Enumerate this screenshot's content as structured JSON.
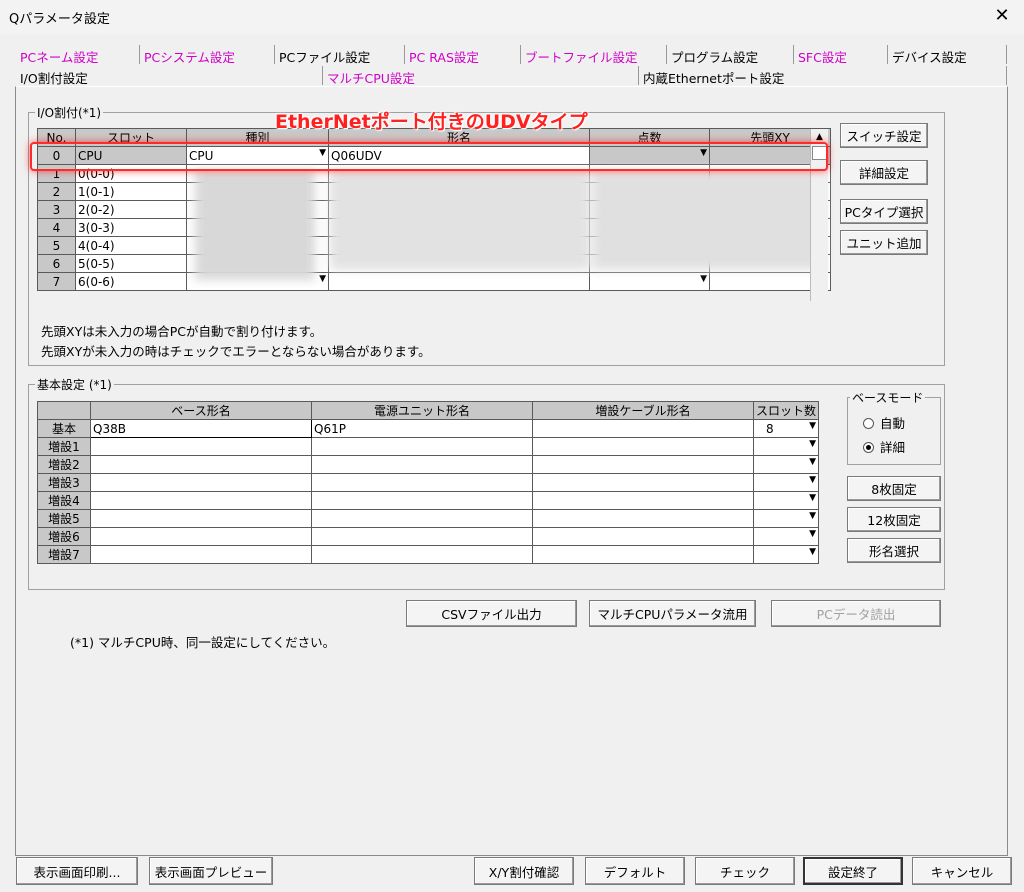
{
  "window": {
    "title": "Qパラメータ設定",
    "close_glyph": "✕"
  },
  "tabs_row1": [
    {
      "label": "PCネーム設定",
      "color": "#d000c8"
    },
    {
      "label": "PCシステム設定",
      "color": "#d000c8"
    },
    {
      "label": "PCファイル設定",
      "color": "#000000"
    },
    {
      "label": "PC RAS設定",
      "color": "#d000c8"
    },
    {
      "label": "ブートファイル設定",
      "color": "#d000c8"
    },
    {
      "label": "プログラム設定",
      "color": "#000000"
    },
    {
      "label": "SFC設定",
      "color": "#d000c8"
    },
    {
      "label": "デバイス設定",
      "color": "#000000"
    }
  ],
  "tabs_row2": [
    {
      "label": "I/O割付設定",
      "color": "#000000",
      "active": true
    },
    {
      "label": "マルチCPU設定",
      "color": "#d000c8"
    },
    {
      "label": "内蔵Ethernetポート設定",
      "color": "#000000"
    }
  ],
  "io": {
    "legend": "I/O割付(*1)",
    "callout": "EtherNetポート付きのUDVタイプ",
    "headers": [
      "No.",
      "スロット",
      "種別",
      "形名",
      "点数",
      "先頭XY"
    ],
    "rows": [
      {
        "no": "0",
        "slot": "CPU",
        "type": "CPU",
        "model": "Q06UDV",
        "points": "",
        "head": ""
      },
      {
        "no": "1",
        "slot": "0(0-0)"
      },
      {
        "no": "2",
        "slot": "1(0-1)"
      },
      {
        "no": "3",
        "slot": "2(0-2)"
      },
      {
        "no": "4",
        "slot": "3(0-3)"
      },
      {
        "no": "5",
        "slot": "4(0-4)"
      },
      {
        "no": "6",
        "slot": "5(0-5)"
      },
      {
        "no": "7",
        "slot": "6(0-6)"
      }
    ],
    "buttons": [
      "スイッチ設定",
      "詳細設定",
      "PCタイプ選択",
      "ユニット追加"
    ],
    "note1": "先頭XYは未入力の場合PCが自動で割り付けます。",
    "note2": "先頭XYが未入力の時はチェックでエラーとならない場合があります。"
  },
  "basic": {
    "legend": "基本設定 (*1)",
    "headers": [
      "ベース形名",
      "電源ユニット形名",
      "増設ケーブル形名",
      "スロット数"
    ],
    "rows": [
      {
        "label": "基本",
        "base": "Q38B",
        "power": "Q61P",
        "cable": "",
        "slots": "8"
      },
      {
        "label": "増設1",
        "base": "",
        "power": "",
        "cable": "",
        "slots": ""
      },
      {
        "label": "増設2",
        "base": "",
        "power": "",
        "cable": "",
        "slots": ""
      },
      {
        "label": "増設3",
        "base": "",
        "power": "",
        "cable": "",
        "slots": ""
      },
      {
        "label": "増設4",
        "base": "",
        "power": "",
        "cable": "",
        "slots": ""
      },
      {
        "label": "増設5",
        "base": "",
        "power": "",
        "cable": "",
        "slots": ""
      },
      {
        "label": "増設6",
        "base": "",
        "power": "",
        "cable": "",
        "slots": ""
      },
      {
        "label": "増設7",
        "base": "",
        "power": "",
        "cable": "",
        "slots": ""
      }
    ],
    "base_mode": {
      "legend": "ベースモード",
      "auto": "自動",
      "detail": "詳細",
      "selected": "detail"
    },
    "buttons": [
      "8枚固定",
      "12枚固定",
      "形名選択"
    ]
  },
  "actions": {
    "csv": "CSVファイル出力",
    "multi": "マルチCPUパラメータ流用",
    "read": "PCデータ読出"
  },
  "footnote": "(*1) マルチCPU時、同一設定にしてください。",
  "bottom": {
    "print": "表示画面印刷...",
    "preview": "表示画面プレビュー",
    "xy": "X/Y割付確認",
    "default": "デフォルト",
    "check": "チェック",
    "done": "設定終了",
    "cancel": "キャンセル"
  },
  "dropdown_glyph": "▼",
  "scroll_up_glyph": "▲"
}
